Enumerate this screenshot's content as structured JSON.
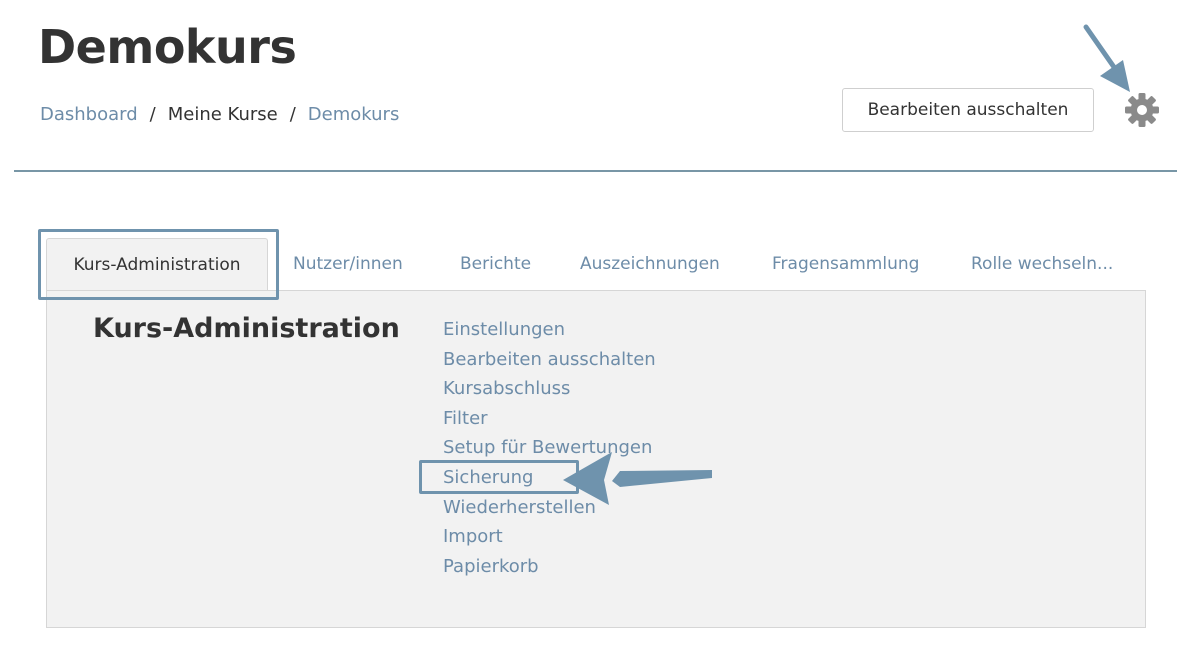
{
  "header": {
    "title": "Demokurs",
    "breadcrumb": [
      {
        "label": "Dashboard",
        "link": true
      },
      {
        "label": "Meine Kurse",
        "link": false
      },
      {
        "label": "Demokurs",
        "link": true
      }
    ],
    "separator": "/",
    "edit_button_label": "Bearbeiten ausschalten",
    "settings_icon": "gear-icon"
  },
  "tabs": [
    {
      "label": "Kurs-Administration",
      "active": true
    },
    {
      "label": "Nutzer/innen",
      "active": false
    },
    {
      "label": "Berichte",
      "active": false
    },
    {
      "label": "Auszeichnungen",
      "active": false
    },
    {
      "label": "Fragensammlung",
      "active": false
    },
    {
      "label": "Rolle wechseln...",
      "active": false
    }
  ],
  "panel": {
    "heading": "Kurs-Administration",
    "items": [
      "Einstellungen",
      "Bearbeiten ausschalten",
      "Kursabschluss",
      "Filter",
      "Setup für Bewertungen",
      "Sicherung",
      "Wiederherstellen",
      "Import",
      "Papierkorb"
    ]
  },
  "colors": {
    "link": "#6d8ca8",
    "text": "#333333",
    "panel_bg": "#f2f2f2",
    "annotation": "#6f93ad"
  }
}
